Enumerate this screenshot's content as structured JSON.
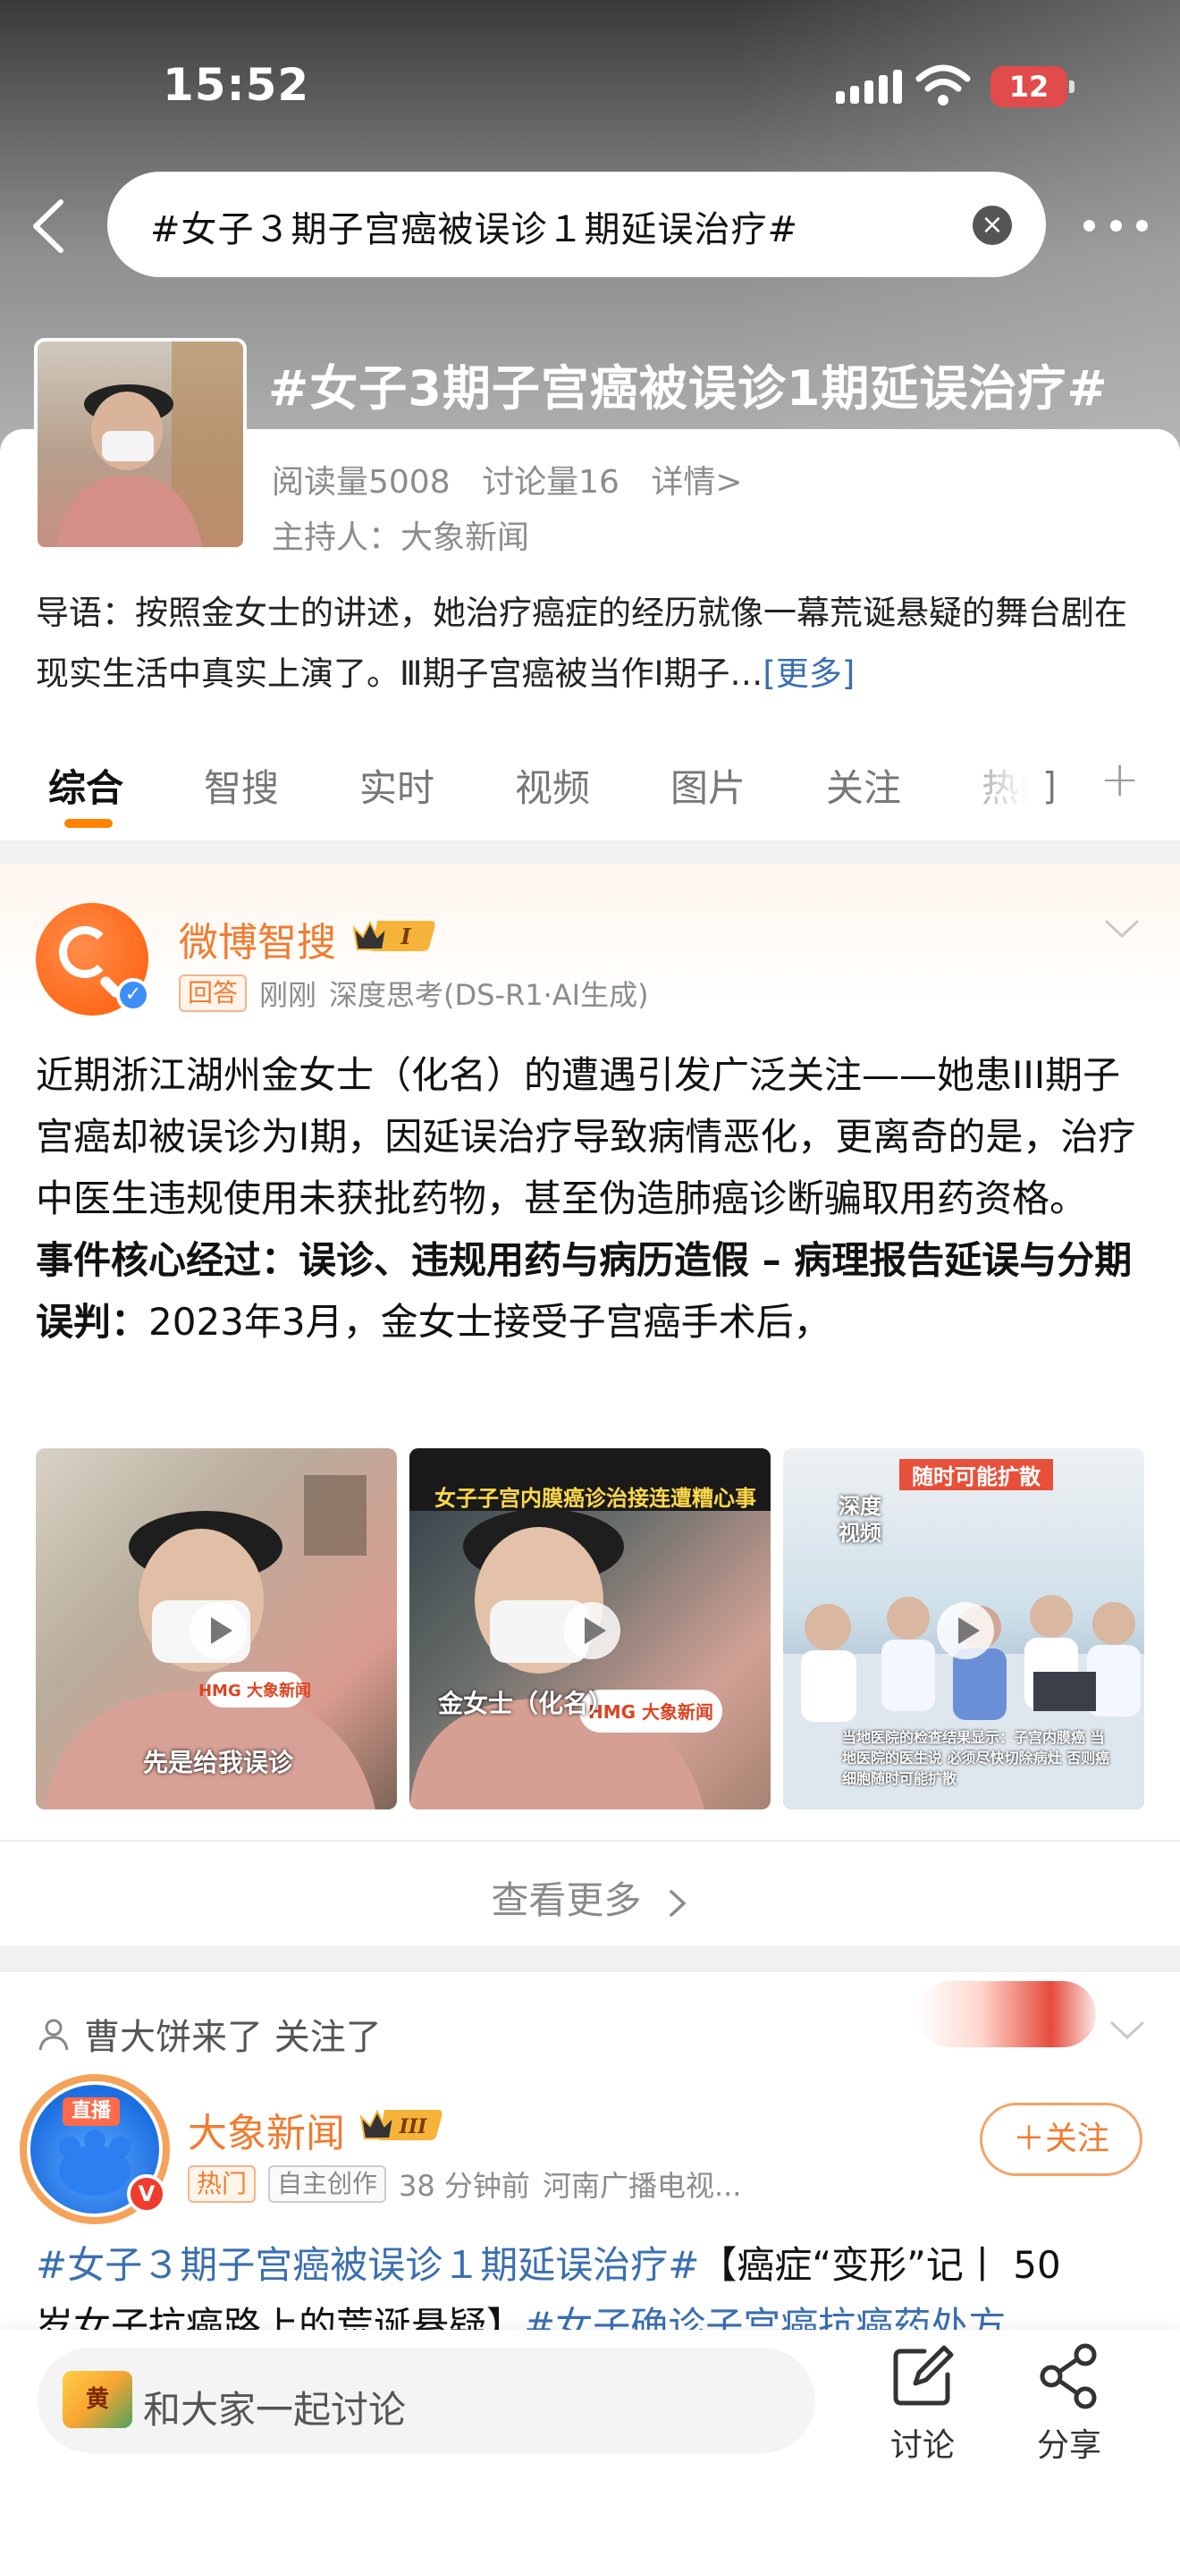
{
  "status_bar": {
    "time": "15:52",
    "battery": "12"
  },
  "search": {
    "query": "#女子３期子宫癌被误诊１期延误治疗#"
  },
  "topic": {
    "title": "#女子3期子宫癌被误诊1期延误治疗#",
    "reads": "阅读量5008",
    "discussions": "讨论量16",
    "details": "详情>",
    "host": "主持人：大象新闻",
    "intro": "导语：按照金女士的讲述，她治疗癌症的经历就像一幕荒诞悬疑的舞台剧在现实生活中真实上演了。Ⅲ期子宫癌被当作Ⅰ期子…",
    "intro_more": "[更多]"
  },
  "tabs": [
    {
      "label": "综合",
      "active": true
    },
    {
      "label": "智搜"
    },
    {
      "label": "实时"
    },
    {
      "label": "视频"
    },
    {
      "label": "图片"
    },
    {
      "label": "关注"
    },
    {
      "label": "热门"
    }
  ],
  "post1": {
    "author": "微博智搜",
    "level_badge": "I",
    "tag": "回答",
    "time": "刚刚",
    "source": "深度思考(DS-R1·AI生成)",
    "body_plain": "近期浙江湖州金女士（化名）的遭遇引发广泛关注——她患III期子宫癌却被误诊为I期，因延误治疗导致病情恶化，更离奇的是，治疗中医生违规使用未获批药物，甚至伪造肺癌诊断骗取用药资格。",
    "body_bold": "事件核心经过：误诊、违规用药与病历造假 – 病理报告延误与分期误判：",
    "body_tail": "2023年3月，金女士接受子宫癌手术后，",
    "thumbs": [
      {
        "caption": "先是给我误诊",
        "logo": "HMG 大象新闻"
      },
      {
        "top_caption": "女子子宫内膜癌诊治接连遭糟心事",
        "caption": "金女士（化名）",
        "logo": "HMG 大象新闻"
      },
      {
        "top_caption": "随时可能扩散",
        "side_caption": "深度视频",
        "caption": "当地医院的检查结果显示：子宫内膜癌 当地医院的医生说 必须尽快切除病灶 否则癌细胞随时可能扩散"
      }
    ],
    "see_more": "查看更多"
  },
  "post2": {
    "follow_note": "曹大饼来了 关注了",
    "live_tag": "直播",
    "author": "大象新闻",
    "level_badge": "III",
    "tag_hot": "热门",
    "tag_original": "自主创作",
    "time": "38 分钟前",
    "source": "河南广播电视...",
    "follow_label": "＋关注",
    "hashtag1": "#女子３期子宫癌被误诊１期延误治疗#",
    "text1": "【癌症“变形”记丨 50",
    "text2": "岁女子抗癌路上的荒诞悬疑】",
    "hashtag2": "#女子确诊子宫癌抗癌药处方"
  },
  "bottom_bar": {
    "mascot": "黄",
    "placeholder": "和大家一起讨论",
    "discuss": "讨论",
    "share": "分享"
  }
}
